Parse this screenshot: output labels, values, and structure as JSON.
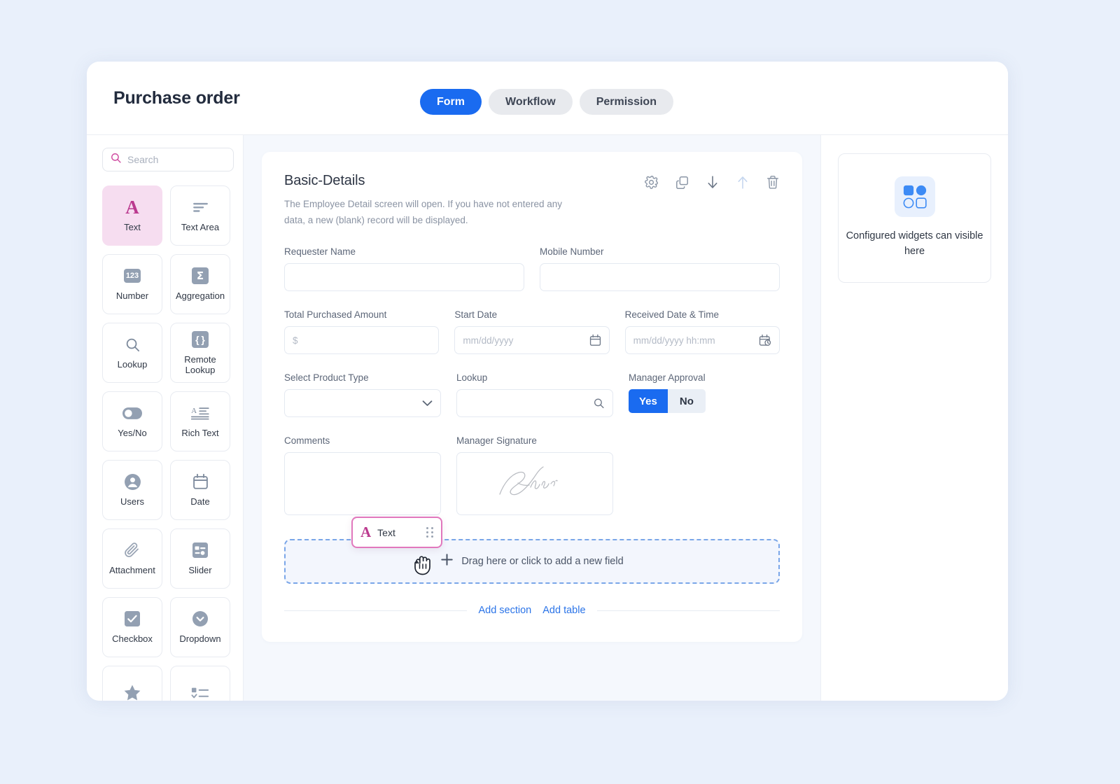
{
  "header": {
    "title": "Purchase order",
    "tabs": [
      {
        "label": "Form",
        "active": true
      },
      {
        "label": "Workflow",
        "active": false
      },
      {
        "label": "Permission",
        "active": false
      }
    ]
  },
  "palette": {
    "search": {
      "placeholder": "Search",
      "value": "",
      "icon": "search-icon"
    },
    "items": [
      {
        "label": "Text",
        "icon": "letter-a-icon",
        "selected": true
      },
      {
        "label": "Text Area",
        "icon": "text-lines-icon",
        "selected": false
      },
      {
        "label": "Number",
        "icon": "123-icon",
        "selected": false
      },
      {
        "label": "Aggregation",
        "icon": "sigma-icon",
        "selected": false
      },
      {
        "label": "Lookup",
        "icon": "magnifier-icon",
        "selected": false
      },
      {
        "label": "Remote Lookup",
        "icon": "braces-icon",
        "selected": false
      },
      {
        "label": "Yes/No",
        "icon": "toggle-icon",
        "selected": false
      },
      {
        "label": "Rich Text",
        "icon": "rich-text-icon",
        "selected": false
      },
      {
        "label": "Users",
        "icon": "user-avatar-icon",
        "selected": false
      },
      {
        "label": "Date",
        "icon": "calendar-icon",
        "selected": false
      },
      {
        "label": "Attachment",
        "icon": "paperclip-icon",
        "selected": false
      },
      {
        "label": "Slider",
        "icon": "slider-icon",
        "selected": false
      },
      {
        "label": "Checkbox",
        "icon": "checkbox-icon",
        "selected": false
      },
      {
        "label": "Dropdown",
        "icon": "chevron-circle-icon",
        "selected": false
      },
      {
        "label": "",
        "icon": "star-icon",
        "selected": false
      },
      {
        "label": "",
        "icon": "multi-select-icon",
        "selected": false
      }
    ]
  },
  "section": {
    "title": "Basic-Details",
    "description": "The Employee Detail screen will open. If you have not entered any data, a new (blank) record will be displayed.",
    "actions": [
      {
        "name": "settings",
        "icon": "gear-icon",
        "disabled": false
      },
      {
        "name": "duplicate",
        "icon": "copy-icon",
        "disabled": false
      },
      {
        "name": "move-down",
        "icon": "arrow-down-icon",
        "disabled": false
      },
      {
        "name": "move-up",
        "icon": "arrow-up-icon",
        "disabled": true
      },
      {
        "name": "delete",
        "icon": "trash-icon",
        "disabled": false
      }
    ],
    "fields": {
      "requester_name": {
        "label": "Requester Name",
        "value": "",
        "placeholder": ""
      },
      "mobile_number": {
        "label": "Mobile Number",
        "value": "",
        "placeholder": ""
      },
      "total_amount": {
        "label": "Total Purchased Amount",
        "value": "",
        "placeholder": "$"
      },
      "start_date": {
        "label": "Start Date",
        "value": "",
        "placeholder": "mm/dd/yyyy",
        "icon": "calendar-icon"
      },
      "received_dt": {
        "label": "Received Date & Time",
        "value": "",
        "placeholder": "mm/dd/yyyy  hh:mm",
        "icon": "calendar-clock-icon"
      },
      "product_type": {
        "label": "Select Product Type",
        "value": "",
        "icon": "chevron-down-icon"
      },
      "lookup": {
        "label": "Lookup",
        "value": "",
        "placeholder": "",
        "icon": "magnifier-icon"
      },
      "manager_approval": {
        "label": "Manager Approval",
        "yes_label": "Yes",
        "no_label": "No",
        "selected": "Yes"
      },
      "comments": {
        "label": "Comments",
        "value": ""
      },
      "manager_signature": {
        "label": "Manager Signature",
        "icon": "signature-icon"
      }
    },
    "dropzone": {
      "text": "Drag here or click to add a new field",
      "plus_icon": "plus-icon",
      "drag_chip": {
        "label": "Text",
        "icon": "letter-a-icon",
        "handle_icon": "drag-handle-icon",
        "cursor": "grabbing-hand-cursor"
      }
    },
    "add_section_label": "Add section",
    "add_table_label": "Add table"
  },
  "right_panel": {
    "widget_placeholder": {
      "icon": "widgets-grid-icon",
      "text": "Configured widgets can visible here"
    }
  },
  "colors": {
    "page_bg": "#e9f0fb",
    "accent_blue": "#1a6bf0",
    "accent_pink": "#bb3a8f",
    "tile_selected_bg": "#f6ddf0",
    "link_blue": "#2b74e8",
    "canvas_bg": "#f5f8fd"
  }
}
